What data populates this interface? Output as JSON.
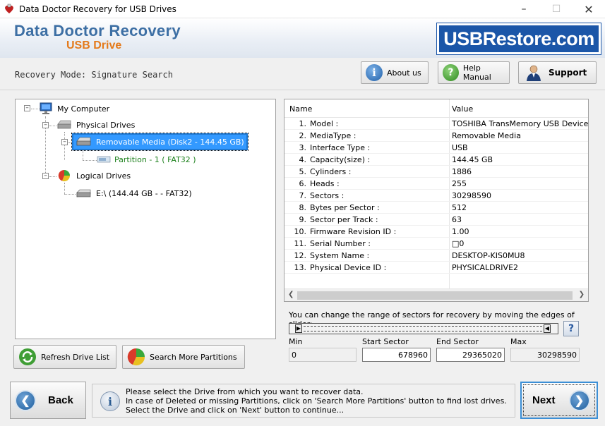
{
  "window": {
    "title": "Data Doctor Recovery for USB Drives"
  },
  "banner": {
    "brand_line1": "Data Doctor Recovery",
    "brand_line2": "USB Drive",
    "logo_text": "USBRestore.com"
  },
  "toolbar": {
    "mode": "Recovery Mode: Signature Search",
    "about_label": "About us",
    "help_label": "Help Manual",
    "support_label": "Support"
  },
  "tree": {
    "root": "My Computer",
    "physical": "Physical Drives",
    "removable": "Removable Media (Disk2 - 144.45 GB)",
    "partition": "Partition - 1 ( FAT32 )",
    "logical": "Logical Drives",
    "drive_e": "E:\\ (144.44 GB -  - FAT32)"
  },
  "properties": {
    "col_name": "Name",
    "col_value": "Value",
    "rows": [
      {
        "n": "1.",
        "name": "Model :",
        "value": "TOSHIBA TransMemory USB Device"
      },
      {
        "n": "2.",
        "name": "MediaType :",
        "value": "Removable Media"
      },
      {
        "n": "3.",
        "name": "Interface Type :",
        "value": "USB"
      },
      {
        "n": "4.",
        "name": "Capacity(size) :",
        "value": "144.45 GB"
      },
      {
        "n": "5.",
        "name": "Cylinders :",
        "value": "1886"
      },
      {
        "n": "6.",
        "name": "Heads :",
        "value": "255"
      },
      {
        "n": "7.",
        "name": "Sectors :",
        "value": "30298590"
      },
      {
        "n": "8.",
        "name": "Bytes per Sector :",
        "value": "512"
      },
      {
        "n": "9.",
        "name": "Sector per Track :",
        "value": "63"
      },
      {
        "n": "10.",
        "name": "Firmware Revision ID :",
        "value": "1.00"
      },
      {
        "n": "11.",
        "name": "Serial Number :",
        "value": "□0"
      },
      {
        "n": "12.",
        "name": "System Name :",
        "value": "DESKTOP-KIS0MU8"
      },
      {
        "n": "13.",
        "name": "Physical Device ID :",
        "value": "PHYSICALDRIVE2"
      }
    ]
  },
  "slider": {
    "description": "You can change the range of sectors for recovery by moving the edges of slider:",
    "min_label": "Min",
    "min_value": "0",
    "start_label": "Start Sector",
    "start_value": "678960",
    "end_label": "End Sector",
    "end_value": "29365020",
    "max_label": "Max",
    "max_value": "30298590"
  },
  "actions": {
    "refresh": "Refresh Drive List",
    "search_more": "Search More Partitions"
  },
  "nav": {
    "back": "Back",
    "next": "Next"
  },
  "info": {
    "line1": "Please select the Drive from which you want to recover data.",
    "line2": "In case of Deleted or missing Partitions, click on 'Search More Partitions' button to find lost drives.",
    "line3": "Select the Drive and click on 'Next' button to continue..."
  },
  "colors": {
    "brand_blue": "#3d6fa4",
    "brand_orange": "#e47a1b",
    "logo_bg": "#1b56a8",
    "selection": "#3399ff",
    "partition_text": "#1a7f1a"
  }
}
